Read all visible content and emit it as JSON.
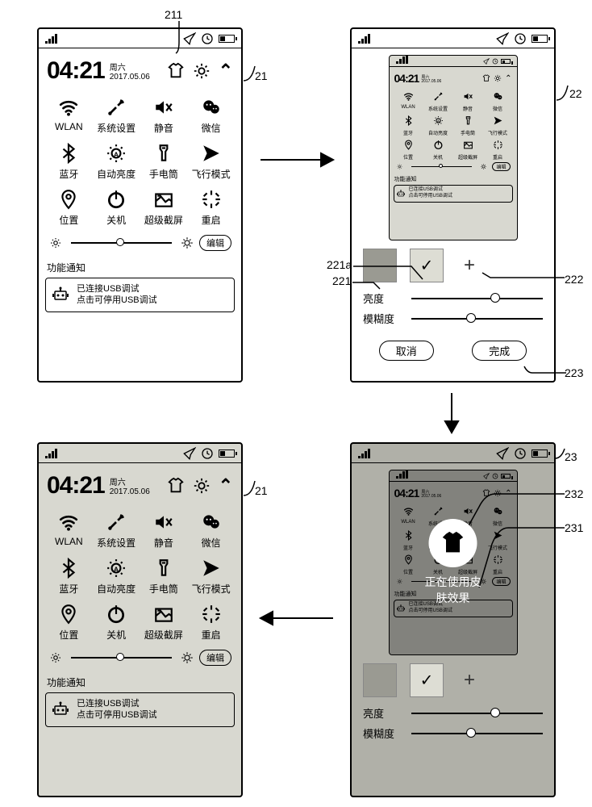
{
  "callouts": {
    "c211": "211",
    "c21": "21",
    "c22": "22",
    "c221": "221",
    "c221a": "221a",
    "c222": "222",
    "c223": "223",
    "c23": "23",
    "c231": "231",
    "c232": "232",
    "c21b": "21"
  },
  "status": {
    "time": "04:21",
    "day": "周六",
    "date": "2017.05.06"
  },
  "header_icons": {
    "tshirt": "tshirt",
    "gear": "gear",
    "caret": "^"
  },
  "tiles": [
    {
      "name": "wifi",
      "label": "WLAN"
    },
    {
      "name": "tools",
      "label": "系统设置"
    },
    {
      "name": "mute",
      "label": "静音"
    },
    {
      "name": "wechat",
      "label": "微信"
    },
    {
      "name": "bluetooth",
      "label": "蓝牙"
    },
    {
      "name": "brightness",
      "label": "自动亮度"
    },
    {
      "name": "flashlight",
      "label": "手电筒"
    },
    {
      "name": "airplane",
      "label": "飞行模式"
    },
    {
      "name": "location",
      "label": "位置"
    },
    {
      "name": "power",
      "label": "关机"
    },
    {
      "name": "screenshot",
      "label": "超级截屏"
    },
    {
      "name": "restart",
      "label": "重启"
    }
  ],
  "edit_label": "编辑",
  "notify_section": "功能通知",
  "notify": {
    "title": "已连接USB调试",
    "sub": "点击可停用USB调试"
  },
  "palette": {
    "brightness_label": "亮度",
    "blur_label": "模糊度",
    "cancel": "取消",
    "done": "完成",
    "brightness_pos": 0.6,
    "blur_pos": 0.42
  },
  "applying": {
    "text": "正在使用皮肤效果"
  },
  "chart_data": {
    "type": "diagram",
    "flow": [
      "21",
      "22",
      "23",
      "21(final)"
    ],
    "direction": "clockwise-rectangle",
    "annotations": {
      "211": "theme/tshirt icon in header of screen 21",
      "221": "dark swatch option",
      "221a": "light swatch option (checked)",
      "222": "add (+) new swatch",
      "223": "done button",
      "231": "applying-skin toast text",
      "232": "applying-skin circle icon"
    }
  }
}
